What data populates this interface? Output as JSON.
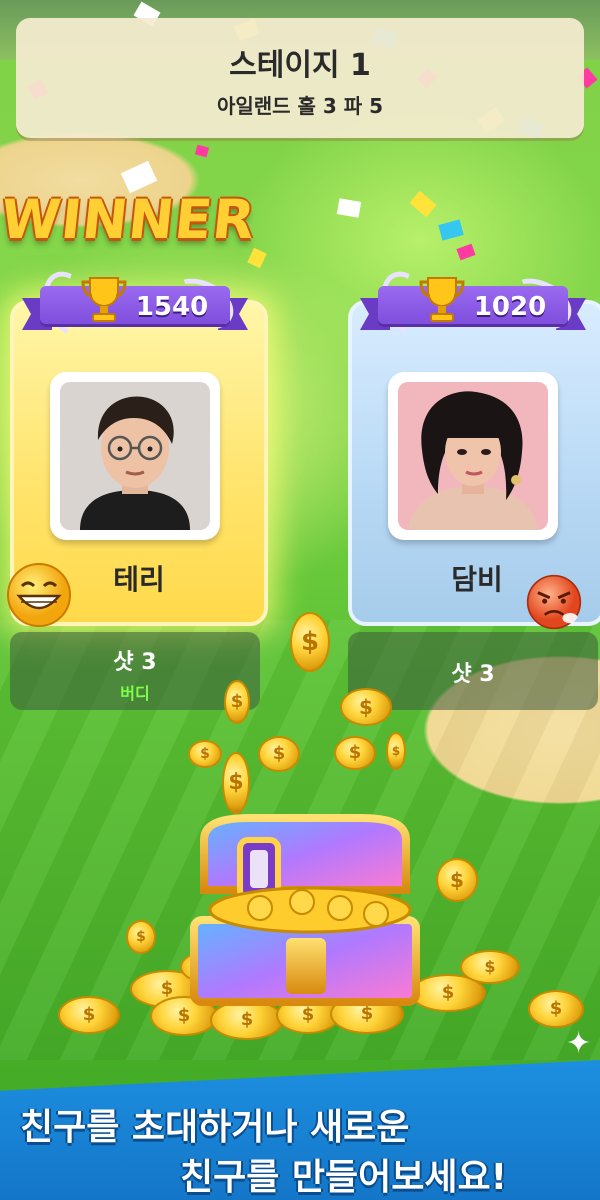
{
  "stage": {
    "title": "스테이지 1",
    "subtitle": "아일랜드 홀 3 파 5"
  },
  "winner_label": "WINNER",
  "players": [
    {
      "name": "테리",
      "score": "1540",
      "shot": "샷 3",
      "result": "버디",
      "reaction": "grinning-emoji-icon",
      "card_color": "#ffe36a"
    },
    {
      "name": "담비",
      "score": "1020",
      "shot": "샷 3",
      "result": "",
      "reaction": "angry-emoji-icon",
      "card_color": "#b7d8f4"
    }
  ],
  "colors": {
    "ribbon": "#8a5ae8",
    "promo_band": "#1a86d8",
    "birdie_text": "#7cff4a"
  },
  "promo": {
    "line1": "친구를 초대하거나 새로운",
    "line2": "친구를 만들어보세요!"
  }
}
